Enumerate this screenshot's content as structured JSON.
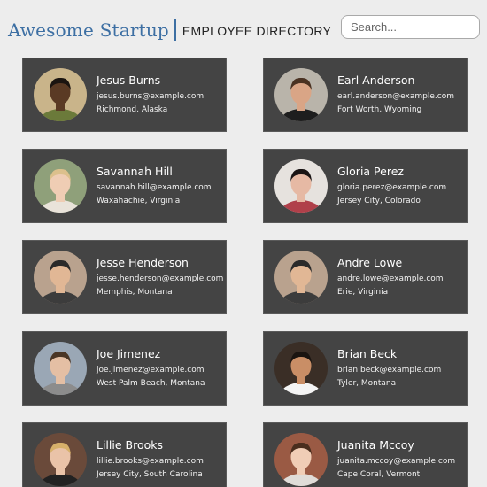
{
  "header": {
    "brand": "Awesome Startup",
    "subtitle": "EMPLOYEE DIRECTORY",
    "search_placeholder": "Search..."
  },
  "employees": [
    {
      "name": "Jesus Burns",
      "email": "jesus.burns@example.com",
      "location": "Richmond, Alaska",
      "bg": "#c9b48a",
      "skin": "#5a3a24",
      "hair": "#1b1410",
      "shirt": "#6b7a3a"
    },
    {
      "name": "Earl Anderson",
      "email": "earl.anderson@example.com",
      "location": "Fort Worth, Wyoming",
      "bg": "#b9b4aa",
      "skin": "#d9a586",
      "hair": "#4a3222",
      "shirt": "#1e1e1e"
    },
    {
      "name": "Savannah Hill",
      "email": "savannah.hill@example.com",
      "location": "Waxahachie, Virginia",
      "bg": "#8fa07a",
      "skin": "#efcdb4",
      "hair": "#dcc08c",
      "shirt": "#e9e3da"
    },
    {
      "name": "Gloria Perez",
      "email": "gloria.perez@example.com",
      "location": "Jersey City, Colorado",
      "bg": "#e6e2de",
      "skin": "#e6b9a4",
      "hair": "#1a1414",
      "shirt": "#b0404a"
    },
    {
      "name": "Jesse Henderson",
      "email": "jesse.henderson@example.com",
      "location": "Memphis, Montana",
      "bg": "#b9a28e",
      "skin": "#e1b795",
      "hair": "#2a2a2a",
      "shirt": "#3c3c3c"
    },
    {
      "name": "Andre Lowe",
      "email": "andre.lowe@example.com",
      "location": "Erie, Virginia",
      "bg": "#b9a28e",
      "skin": "#e1b795",
      "hair": "#2a2a2a",
      "shirt": "#3c3c3c"
    },
    {
      "name": "Joe Jimenez",
      "email": "joe.jimenez@example.com",
      "location": "West Palm Beach, Montana",
      "bg": "#9aa7b5",
      "skin": "#e4bfa4",
      "hair": "#4a3626",
      "shirt": "#8c8c8c"
    },
    {
      "name": "Brian Beck",
      "email": "brian.beck@example.com",
      "location": "Tyler, Montana",
      "bg": "#3a2e26",
      "skin": "#c98e66",
      "hair": "#1a1410",
      "shirt": "#f4f4f4"
    },
    {
      "name": "Lillie Brooks",
      "email": "lillie.brooks@example.com",
      "location": "Jersey City, South Carolina",
      "bg": "#6a4a3a",
      "skin": "#eac3a8",
      "hair": "#d7b06a",
      "shirt": "#222222"
    },
    {
      "name": "Juanita Mccoy",
      "email": "juanita.mccoy@example.com",
      "location": "Cape Coral, Vermont",
      "bg": "#9a5a44",
      "skin": "#f0cdb6",
      "hair": "#4a2e1e",
      "shirt": "#e0dcd8"
    }
  ]
}
